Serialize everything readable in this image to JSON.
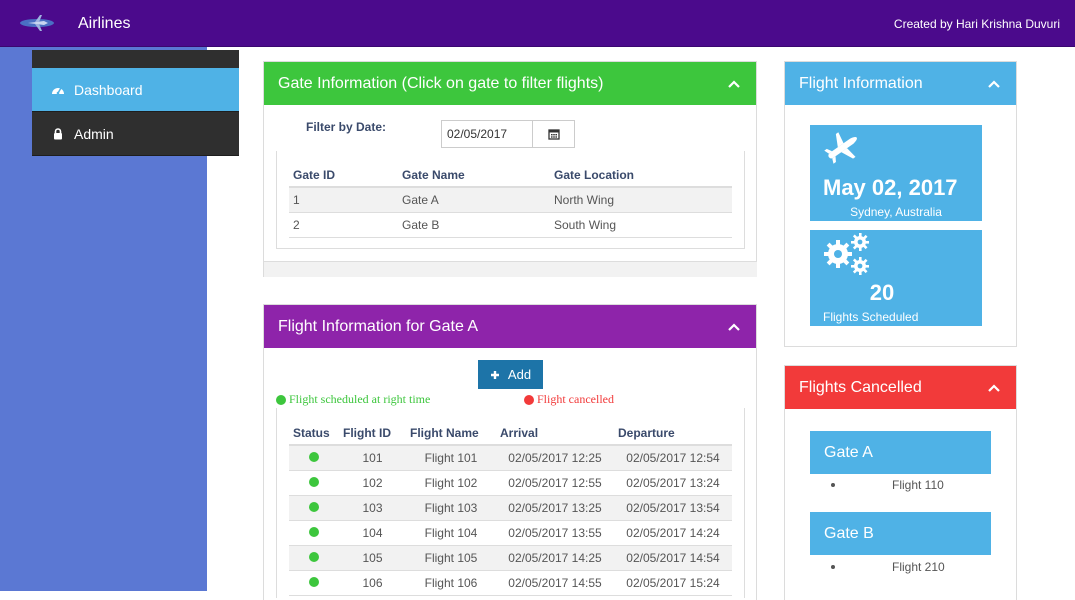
{
  "header": {
    "app_name": "Airlines",
    "creator": "Created by Hari Krishna Duvuri",
    "logo_icon": "airplane-icon"
  },
  "sidebar": {
    "items": [
      {
        "label": "Dashboard",
        "icon": "dashboard-icon",
        "active": true
      },
      {
        "label": "Admin",
        "icon": "lock-icon",
        "active": false
      }
    ]
  },
  "gate_panel": {
    "title": "Gate Information (Click on gate to filter flights)",
    "filter_label": "Filter by Date:",
    "date_value": "02/05/2017",
    "columns": [
      "Gate ID",
      "Gate Name",
      "Gate Location"
    ],
    "rows": [
      {
        "id": "1",
        "name": "Gate A",
        "location": "North Wing"
      },
      {
        "id": "2",
        "name": "Gate B",
        "location": "South Wing"
      }
    ]
  },
  "flight_panel": {
    "title": "Flight Information for Gate A",
    "add_label": "Add",
    "legend_ok": "Flight scheduled at right time",
    "legend_cancel": "Flight cancelled",
    "columns": [
      "Status",
      "Flight ID",
      "Flight Name",
      "Arrival",
      "Departure"
    ],
    "rows": [
      {
        "status": "ok",
        "id": "101",
        "name": "Flight 101",
        "arrival": "02/05/2017 12:25",
        "departure": "02/05/2017 12:54"
      },
      {
        "status": "ok",
        "id": "102",
        "name": "Flight 102",
        "arrival": "02/05/2017 12:55",
        "departure": "02/05/2017 13:24"
      },
      {
        "status": "ok",
        "id": "103",
        "name": "Flight 103",
        "arrival": "02/05/2017 13:25",
        "departure": "02/05/2017 13:54"
      },
      {
        "status": "ok",
        "id": "104",
        "name": "Flight 104",
        "arrival": "02/05/2017 13:55",
        "departure": "02/05/2017 14:24"
      },
      {
        "status": "ok",
        "id": "105",
        "name": "Flight 105",
        "arrival": "02/05/2017 14:25",
        "departure": "02/05/2017 14:54"
      },
      {
        "status": "ok",
        "id": "106",
        "name": "Flight 106",
        "arrival": "02/05/2017 14:55",
        "departure": "02/05/2017 15:24"
      }
    ]
  },
  "info_panel": {
    "title": "Flight Information",
    "date": "May 02, 2017",
    "location": "Sydney, Australia",
    "count": "20",
    "count_label": "Flights Scheduled"
  },
  "cancelled_panel": {
    "title": "Flights Cancelled",
    "gates": [
      {
        "name": "Gate A",
        "flights": [
          "Flight 110"
        ]
      },
      {
        "name": "Gate B",
        "flights": [
          "Flight 210"
        ]
      }
    ]
  },
  "colors": {
    "header": "#4b0a8c",
    "green": "#3dc63d",
    "purple": "#8e24aa",
    "blue": "#4fb2e6",
    "red": "#f23a3a",
    "status_ok": "#3dc63d",
    "status_cancel": "#f23a3a"
  }
}
